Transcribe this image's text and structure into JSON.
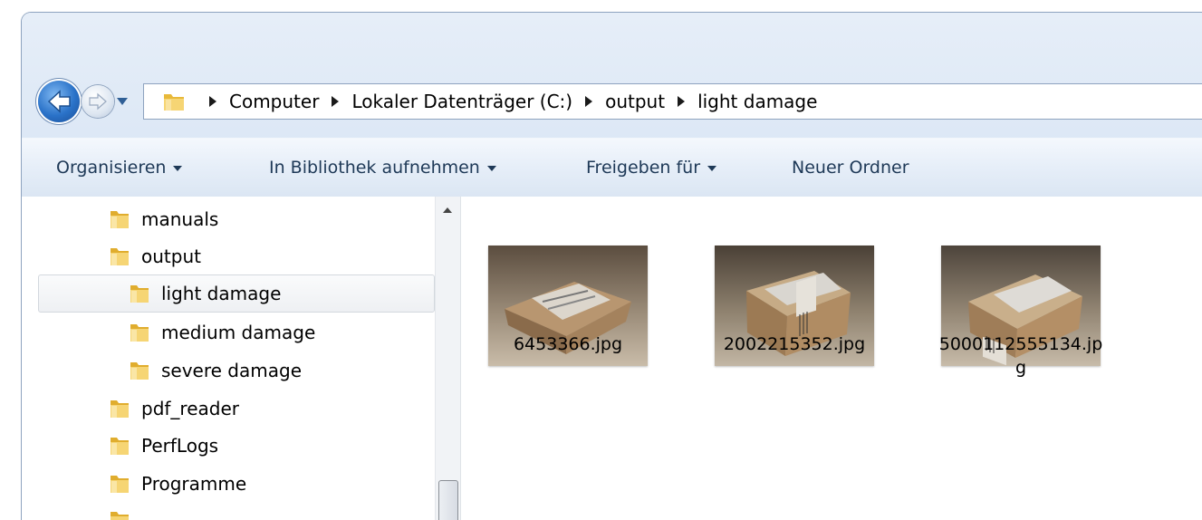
{
  "address_bar": {
    "breadcrumbs": [
      "Computer",
      "Lokaler Datenträger (C:)",
      "output",
      "light damage"
    ]
  },
  "toolbar": {
    "organize_label": "Organisieren",
    "library_label": "In Bibliothek aufnehmen",
    "share_label": "Freigeben für",
    "new_folder_label": "Neuer Ordner"
  },
  "nav_tree": {
    "items": [
      {
        "label": "manuals"
      },
      {
        "label": "output"
      },
      {
        "label": "light damage",
        "selected": true
      },
      {
        "label": "medium damage"
      },
      {
        "label": "severe damage"
      },
      {
        "label": "pdf_reader"
      },
      {
        "label": "PerfLogs"
      },
      {
        "label": "Programme"
      }
    ]
  },
  "files": [
    {
      "name": "6453366.jpg",
      "thumbnail": "box-photo-1"
    },
    {
      "name": "2002215352.jpg",
      "thumbnail": "box-photo-2"
    },
    {
      "name": "5000112555134.jpg",
      "name_line1": "5000112555134.jp",
      "name_line2": "g",
      "thumbnail": "box-photo-3"
    }
  ],
  "colors": {
    "toolbar_text": "#1e3957",
    "window_frame": "#cfdff2",
    "folder_yellow": "#e8b93a"
  },
  "icons": [
    "back-arrow-icon",
    "forward-arrow-icon",
    "history-dropdown-icon",
    "folder-icon",
    "breadcrumb-separator-icon",
    "dropdown-caret-icon",
    "scroll-up-icon"
  ]
}
